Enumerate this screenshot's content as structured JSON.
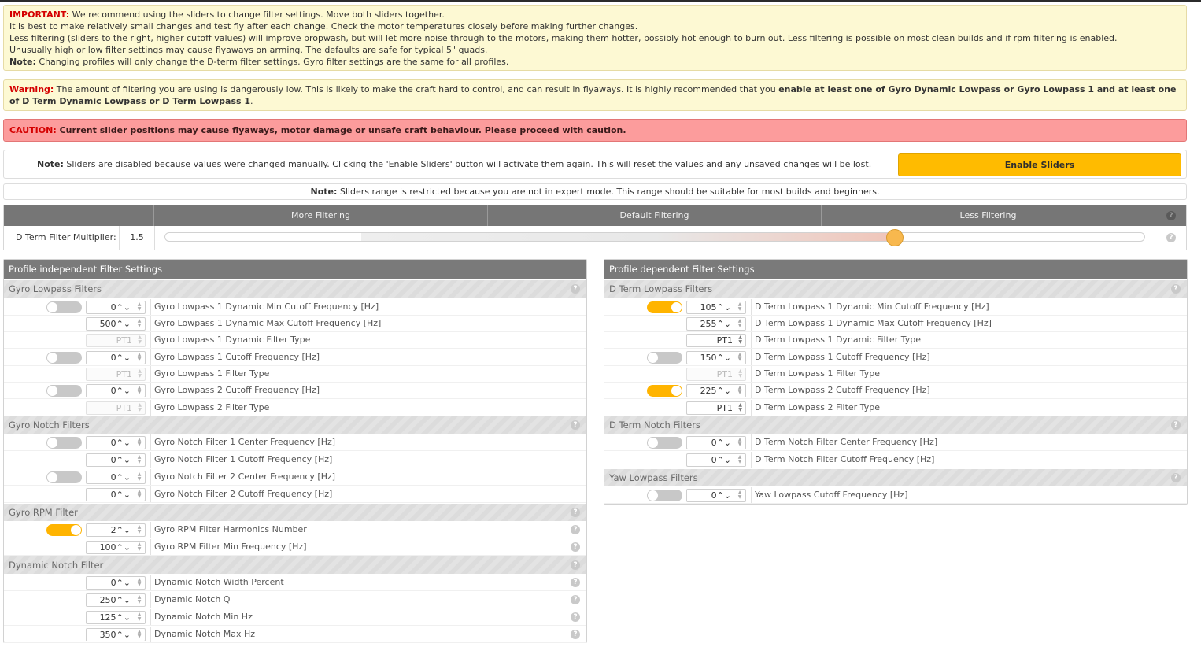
{
  "notices": {
    "important_label": "IMPORTANT:",
    "important_line1": "We recommend using the sliders to change filter settings. Move both sliders together.",
    "important_line2": "It is best to make relatively small changes and test fly after each change. Check the motor temperatures closely before making further changes.",
    "important_line3": "Less filtering (sliders to the right, higher cutoff values) will improve propwash, but will let more noise through to the motors, making them hotter, possibly hot enough to burn out. Less filtering is possible on most clean builds and if rpm filtering is enabled.",
    "important_line4": "Unusually high or low filter settings may cause flyaways on arming. The defaults are safe for typical 5\" quads.",
    "note_label": "Note:",
    "note_text": "Changing profiles will only change the D-term filter settings. Gyro filter settings are the same for all profiles.",
    "warning_label": "Warning:",
    "warning_text": "The amount of filtering you are using is dangerously low. This is likely to make the craft hard to control, and can result in flyaways. It is highly recommended that you",
    "warning_bold": "enable at least one of Gyro Dynamic Lowpass or Gyro Lowpass 1 and at least one of D Term Dynamic Lowpass or D Term Lowpass 1",
    "warning_end": ".",
    "caution_label": "CAUTION:",
    "caution_text": "Current slider positions may cause flyaways, motor damage or unsafe craft behaviour. Please proceed with caution.",
    "sliders_note_label": "Note:",
    "sliders_note_text": "Sliders are disabled because values were changed manually. Clicking the 'Enable Sliders' button will activate them again. This will reset the values and any unsaved changes will be lost.",
    "enable_sliders_label": "Enable Sliders",
    "range_note_label": "Note:",
    "range_note_text": "Sliders range is restricted because you are not in expert mode. This range should be suitable for most builds and beginners."
  },
  "slider": {
    "col_more": "More Filtering",
    "col_default": "Default Filtering",
    "col_less": "Less Filtering",
    "label": "D Term Filter Multiplier:",
    "value": "1.5",
    "position_fraction": 0.745
  },
  "left_panel": {
    "title": "Profile independent Filter Settings",
    "gyro_lowpass_title": "Gyro Lowpass Filters",
    "gyro_notch_title": "Gyro Notch Filters",
    "gyro_rpm_title": "Gyro RPM Filter",
    "dyn_notch_title": "Dynamic Notch Filter",
    "rows": [
      {
        "value": "0",
        "label": "Gyro Lowpass 1 Dynamic Min Cutoff Frequency [Hz]"
      },
      {
        "value": "500",
        "label": "Gyro Lowpass 1 Dynamic Max Cutoff Frequency [Hz]"
      },
      {
        "value": "PT1",
        "label": "Gyro Lowpass 1 Dynamic Filter Type"
      },
      {
        "value": "0",
        "label": "Gyro Lowpass 1 Cutoff Frequency [Hz]"
      },
      {
        "value": "PT1",
        "label": "Gyro Lowpass 1 Filter Type"
      },
      {
        "value": "0",
        "label": "Gyro Lowpass 2 Cutoff Frequency [Hz]"
      },
      {
        "value": "PT1",
        "label": "Gyro Lowpass 2 Filter Type"
      },
      {
        "value": "0",
        "label": "Gyro Notch Filter 1 Center Frequency [Hz]"
      },
      {
        "value": "0",
        "label": "Gyro Notch Filter 1 Cutoff Frequency [Hz]"
      },
      {
        "value": "0",
        "label": "Gyro Notch Filter 2 Center Frequency [Hz]"
      },
      {
        "value": "0",
        "label": "Gyro Notch Filter 2 Cutoff Frequency [Hz]"
      },
      {
        "value": "2",
        "label": "Gyro RPM Filter Harmonics Number"
      },
      {
        "value": "100",
        "label": "Gyro RPM Filter Min Frequency [Hz]"
      },
      {
        "value": "0",
        "label": "Dynamic Notch Width Percent"
      },
      {
        "value": "250",
        "label": "Dynamic Notch Q"
      },
      {
        "value": "125",
        "label": "Dynamic Notch Min Hz"
      },
      {
        "value": "350",
        "label": "Dynamic Notch Max Hz"
      }
    ]
  },
  "right_panel": {
    "title": "Profile dependent Filter Settings",
    "dterm_lowpass_title": "D Term Lowpass Filters",
    "dterm_notch_title": "D Term Notch Filters",
    "yaw_lowpass_title": "Yaw Lowpass Filters",
    "rows": [
      {
        "value": "105",
        "label": "D Term Lowpass 1 Dynamic Min Cutoff Frequency [Hz]"
      },
      {
        "value": "255",
        "label": "D Term Lowpass 1 Dynamic Max Cutoff Frequency [Hz]"
      },
      {
        "value": "PT1",
        "label": "D Term Lowpass 1 Dynamic Filter Type"
      },
      {
        "value": "150",
        "label": "D Term Lowpass 1 Cutoff Frequency [Hz]"
      },
      {
        "value": "PT1",
        "label": "D Term Lowpass 1 Filter Type"
      },
      {
        "value": "225",
        "label": "D Term Lowpass 2 Cutoff Frequency [Hz]"
      },
      {
        "value": "PT1",
        "label": "D Term Lowpass 2 Filter Type"
      },
      {
        "value": "0",
        "label": "D Term Notch Filter Center Frequency [Hz]"
      },
      {
        "value": "0",
        "label": "D Term Notch Filter Cutoff Frequency [Hz]"
      },
      {
        "value": "0",
        "label": "Yaw Lowpass Cutoff Frequency [Hz]"
      }
    ]
  },
  "colors": {
    "accent": "#ffbb00",
    "caution_bg": "#fc9c9c",
    "notice_bg": "#fdf9d3",
    "toggle_on": "#ffb400",
    "toggle_off": "#c8c8c8"
  }
}
